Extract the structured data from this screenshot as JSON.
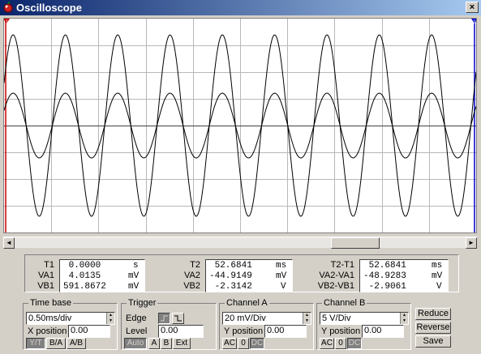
{
  "window": {
    "title": "Oscilloscope",
    "close_label": "×"
  },
  "cursors": {
    "t1_label": "1",
    "t2_label": "2",
    "t1_color": "#cc0000",
    "t2_color": "#0000cc"
  },
  "readout": {
    "t1": {
      "label": "T1",
      "value": " 0.0000",
      "unit": "s"
    },
    "va1": {
      "label": "VA1",
      "value": " 4.0135",
      "unit": "mV"
    },
    "vb1": {
      "label": "VB1",
      "value": "591.8672",
      "unit": "mV"
    },
    "t2": {
      "label": "T2",
      "value": " 52.6841",
      "unit": "ms"
    },
    "va2": {
      "label": "VA2",
      "value": "-44.9149",
      "unit": "mV"
    },
    "vb2": {
      "label": "VB2",
      "value": " -2.3142",
      "unit": "V"
    },
    "dt": {
      "label": "T2-T1",
      "value": " 52.6841",
      "unit": "ms"
    },
    "dva": {
      "label": "VA2-VA1",
      "value": "-48.9283",
      "unit": "mV"
    },
    "dvb": {
      "label": "VB2-VB1",
      "value": " -2.9061",
      "unit": "V"
    }
  },
  "timebase": {
    "title": "Time base",
    "value": "0.50ms/div",
    "xpos_label": "X position",
    "xpos_value": "0.00",
    "mode_yt": "Y/T",
    "mode_ba": "B/A",
    "mode_ab": "A/B"
  },
  "trigger": {
    "title": "Trigger",
    "edge_label": "Edge",
    "level_label": "Level",
    "level_value": "0.00",
    "auto": "Auto",
    "a": "A",
    "b": "B",
    "ext": "Ext"
  },
  "channel_a": {
    "title": "Channel A",
    "value": "20 mV/Div",
    "ypos_label": "Y position",
    "ypos_value": "0.00",
    "ac": "AC",
    "zero": "0",
    "dc": "DC"
  },
  "channel_b": {
    "title": "Channel B",
    "value": "5 V/Div",
    "ypos_label": "Y position",
    "ypos_value": "0.00",
    "ac": "AC",
    "zero": "0",
    "dc": "DC"
  },
  "buttons": {
    "reduce": "Reduce",
    "reverse": "Reverse",
    "save": "Save"
  },
  "scrollbar": {
    "left_arrow": "◄",
    "right_arrow": "►"
  }
}
